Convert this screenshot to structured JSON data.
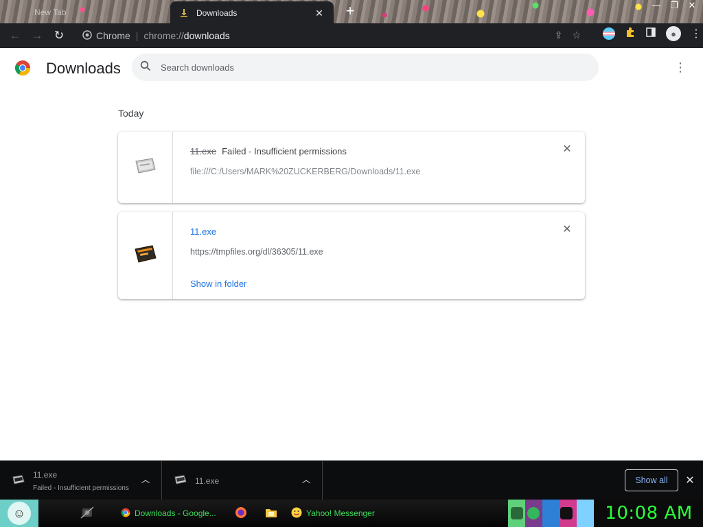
{
  "browser": {
    "inactive_tab_label": "New Tab",
    "active_tab_title": "Downloads",
    "omnibox": {
      "site_label": "Chrome",
      "scheme": "chrome://",
      "host": "downloads"
    }
  },
  "page": {
    "title": "Downloads",
    "search_placeholder": "Search downloads",
    "section_label": "Today"
  },
  "downloads": [
    {
      "file_name": "11.exe",
      "status": "Failed - Insufficient permissions",
      "url": "file:///C:/Users/MARK%20ZUCKERBERG/Downloads/11.exe"
    },
    {
      "file_name": "11.exe",
      "url": "https://tmpfiles.org/dl/36305/11.exe",
      "action": "Show in folder"
    }
  ],
  "shelf": {
    "items": [
      {
        "name": "11.exe",
        "status": "Failed - Insufficient permissions"
      },
      {
        "name": "11.exe"
      }
    ],
    "show_all": "Show all"
  },
  "taskbar": {
    "apps": [
      {
        "label": "Downloads - Google..."
      },
      {
        "label": "Yahoo! Messenger"
      }
    ],
    "clock": "10:08 AM"
  },
  "colors": {
    "accent_link": "#1a73e8",
    "toolbar_bg": "#202124",
    "clock_green": "#2bff3c"
  }
}
